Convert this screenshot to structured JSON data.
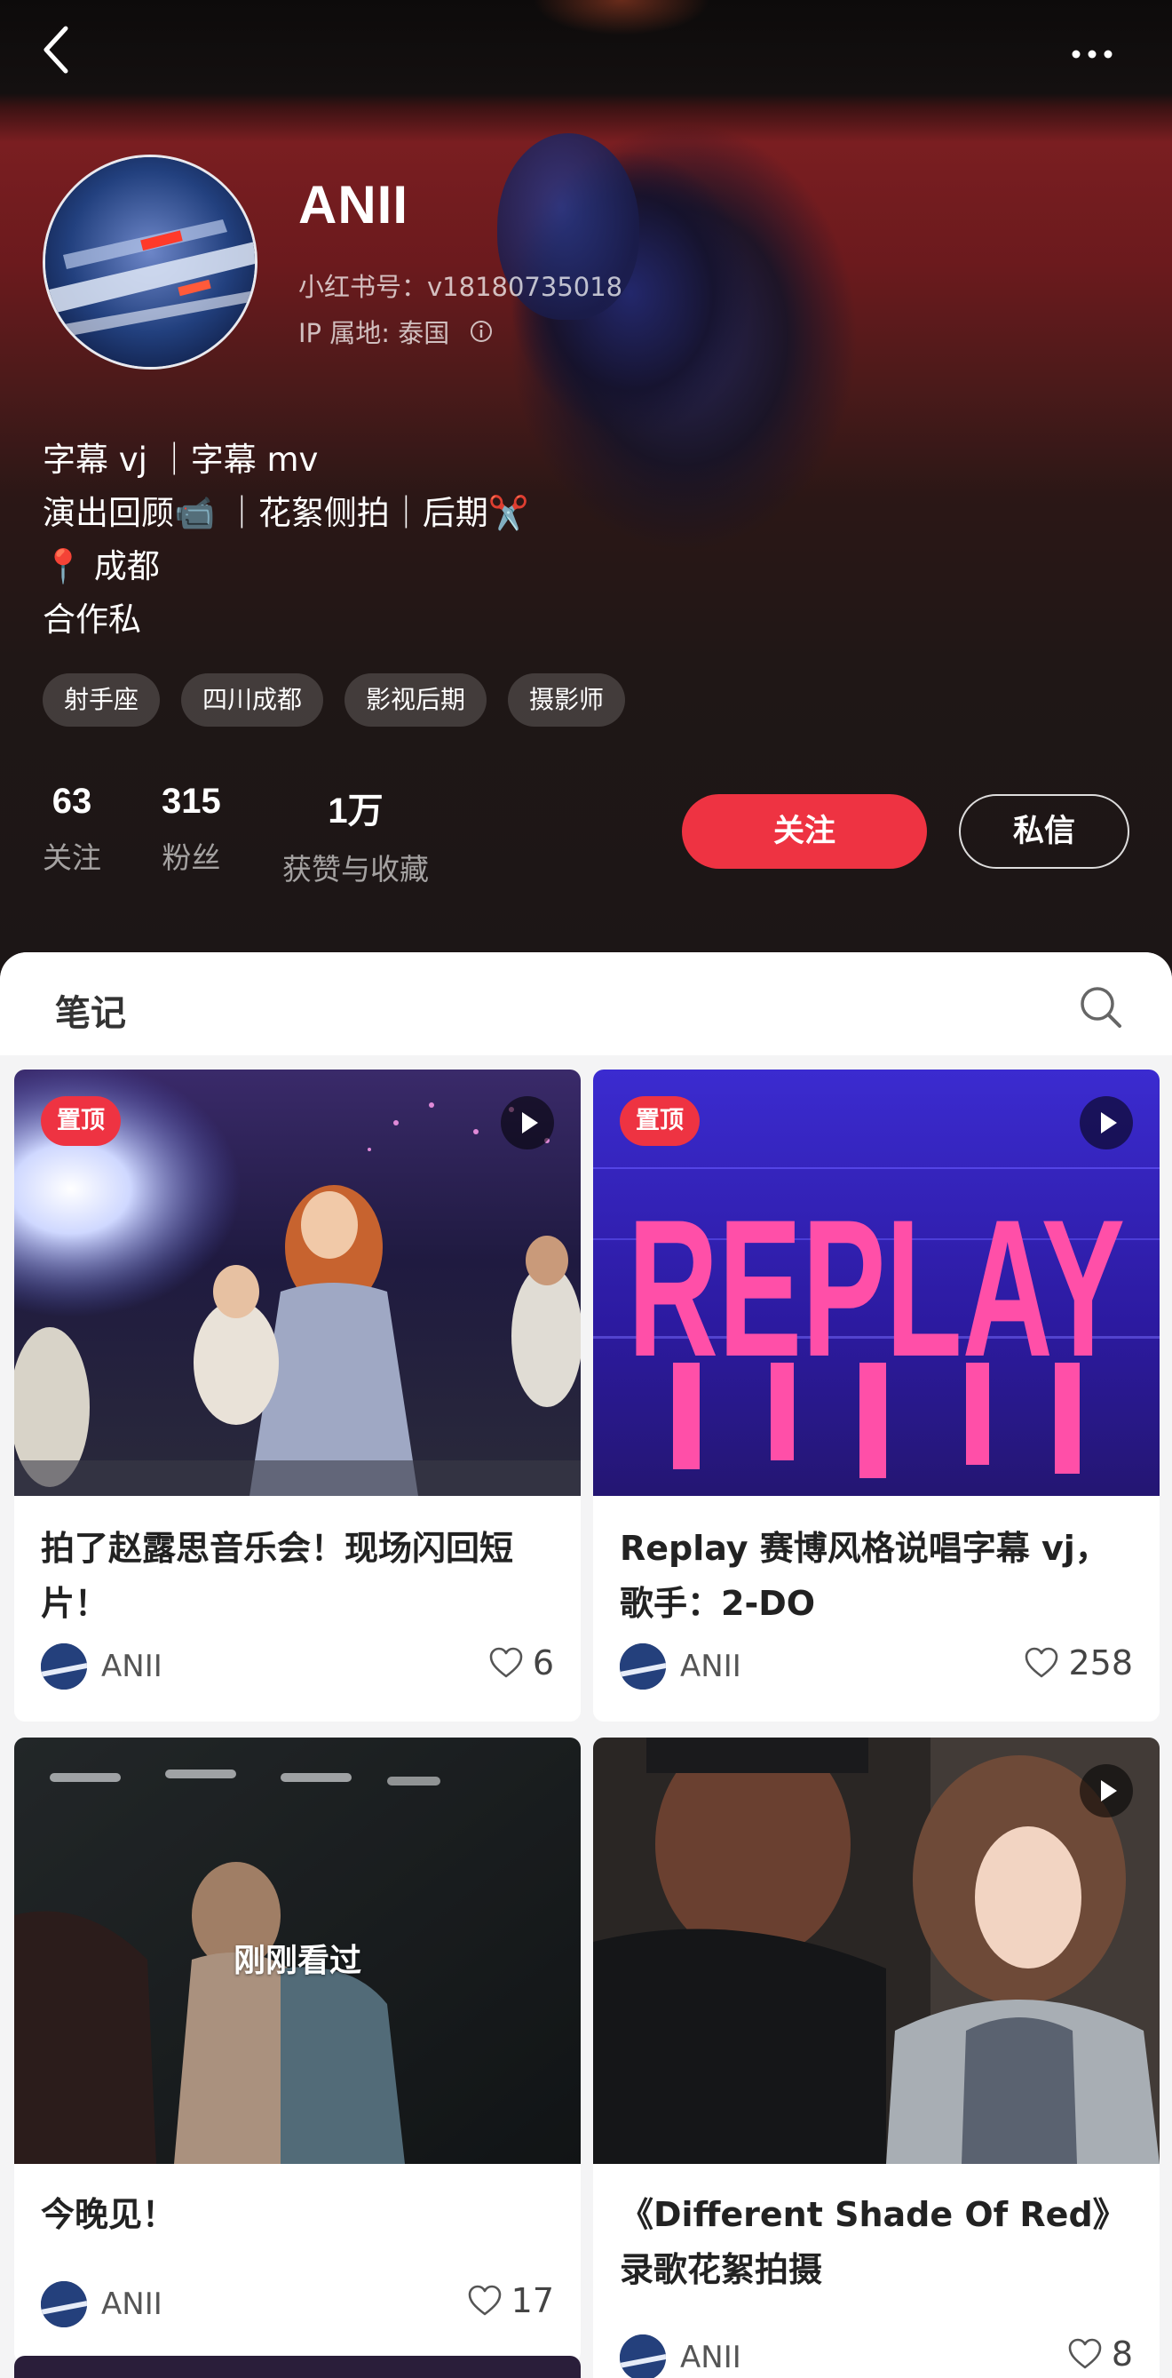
{
  "profile": {
    "nickname": "ANII",
    "red_id": "小红书号：v18180735018",
    "ip_location": "IP 属地: 泰国",
    "bio": [
      "字幕 vj ｜字幕 mv",
      "演出回顾📹 ｜花絮侧拍｜后期✂️",
      "📍 成都",
      "合作私"
    ],
    "tags": [
      "射手座",
      "四川成都",
      "影视后期",
      "摄影师"
    ],
    "stats": [
      {
        "value": "63",
        "label": "关注"
      },
      {
        "value": "315",
        "label": "粉丝"
      },
      {
        "value": "1万",
        "label": "获赞与收藏"
      }
    ],
    "follow_label": "关注",
    "message_label": "私信"
  },
  "notes": {
    "title": "笔记",
    "cards": [
      {
        "title": "拍了赵露思音乐会！现场闪回短片！",
        "author": "ANII",
        "likes": "6",
        "badge": "置顶",
        "video": true
      },
      {
        "title": "Replay 赛博风格说唱字幕 vj，歌手：2-DO",
        "author": "ANII",
        "likes": "258",
        "badge": "置顶",
        "video": true,
        "thumb_text": "REPLAY"
      },
      {
        "title": "今晚见！",
        "author": "ANII",
        "likes": "17",
        "overlay": "刚刚看过"
      },
      {
        "title": "《Different Shade Of Red》录歌花絮拍摄",
        "author": "ANII",
        "likes": "8",
        "video": true
      }
    ]
  },
  "icons": {
    "back": "back-arrow-icon",
    "more": "more-dots-icon",
    "search": "search-icon",
    "info": "info-icon",
    "like": "heart-icon",
    "play": "play-icon"
  },
  "colors": {
    "accent": "#ee3342",
    "header_bg": "#1c1616",
    "panel_bg": "#f4f4f5"
  }
}
